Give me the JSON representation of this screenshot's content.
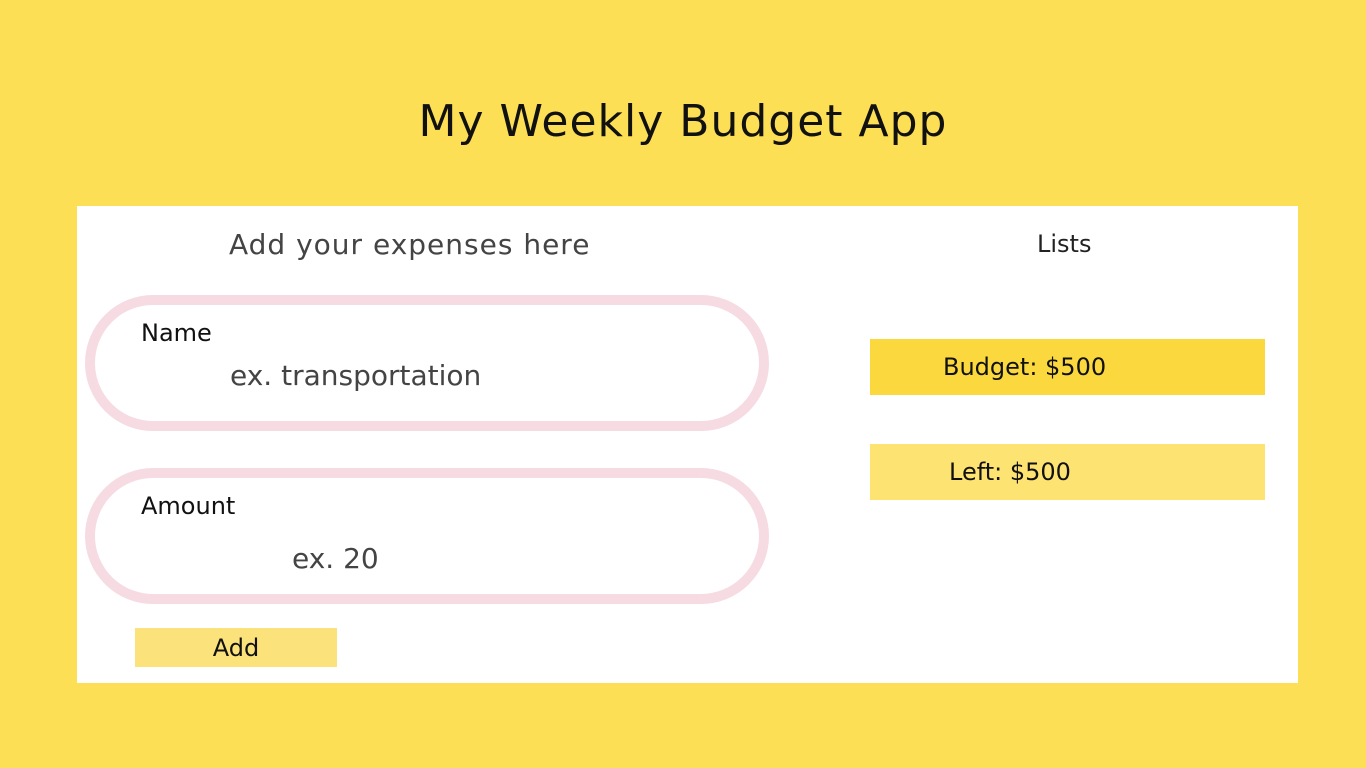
{
  "app": {
    "title": "My Weekly Budget App"
  },
  "form": {
    "heading": "Add your expenses here",
    "name": {
      "label": "Name",
      "placeholder": "ex. transportation",
      "value": ""
    },
    "amount": {
      "label": "Amount",
      "placeholder": "ex. 20",
      "value": ""
    },
    "add_label": "Add"
  },
  "lists": {
    "heading": "Lists",
    "budget": "Budget: $500",
    "left": "Left: $500"
  },
  "colors": {
    "background": "#fddf55",
    "card": "#ffffff",
    "pill_border": "#f6dbe3",
    "budget_bar": "#fad83e",
    "left_bar": "#fde372",
    "add_button": "#fce27a"
  }
}
